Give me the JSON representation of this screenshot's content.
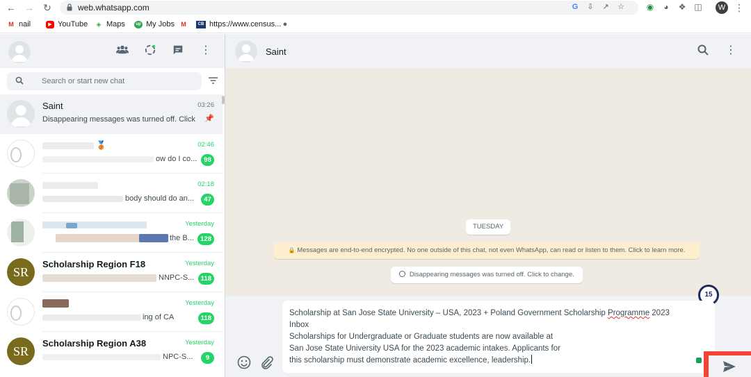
{
  "browser": {
    "url": "web.whatsapp.com",
    "profile_initial": "W",
    "bookmarks": [
      {
        "label": "nail",
        "icon": "gmail-icon"
      },
      {
        "label": "YouTube",
        "icon": "youtube-icon"
      },
      {
        "label": "Maps",
        "icon": "maps-icon"
      },
      {
        "label": "My Jobs",
        "icon": "myjobs-icon"
      },
      {
        "label": "",
        "icon": "gmail-icon"
      },
      {
        "label": "https://www.census...",
        "icon": "census-icon"
      },
      {
        "label": "",
        "icon": "globe-icon"
      }
    ]
  },
  "sidebar": {
    "search_placeholder": "Search or start new chat",
    "chats": [
      {
        "name": "Saint",
        "time": "03:26",
        "preview": "Disappearing messages was turned off. Click ...",
        "badge": "",
        "pinned": true,
        "active": true
      },
      {
        "name": "",
        "time": "02:46",
        "preview": "ow do I co...",
        "badge": "98"
      },
      {
        "name": "",
        "time": "02:18",
        "preview": "body should do an...",
        "badge": "47"
      },
      {
        "name": "",
        "time": "Yesterday",
        "preview": "the B...",
        "badge": "128"
      },
      {
        "name": "Scholarship Region F18",
        "time": "Yesterday",
        "preview": "NNPC-S...",
        "badge": "118",
        "avatar_text": "SR"
      },
      {
        "name": "",
        "time": "Yesterday",
        "preview": "ing of CA",
        "badge": "118"
      },
      {
        "name": "Scholarship Region A38",
        "time": "Yesterday",
        "preview": "NPC-S...",
        "badge": "9",
        "avatar_text": "SR"
      }
    ]
  },
  "conversation": {
    "name": "Saint",
    "date_label": "TUESDAY",
    "encryption_notice": "Messages are end-to-end encrypted. No one outside of this chat, not even WhatsApp, can read or listen to them. Click to learn more.",
    "disappearing_notice": "Disappearing messages was turned off. Click to change.",
    "compose_lines": [
      "Scholarship at San Jose State University – USA, 2023 + Poland Government Scholarship ",
      "Inbox",
      "Scholarships for Undergraduate or Graduate students are now available at",
      "San Jose State University USA for the 2023 academic intakes. Applicants for",
      "this scholarship must demonstrate academic excellence, leadership."
    ],
    "compose_squiggle_word": "Programme",
    "compose_line1_tail": " 2023",
    "counter": "15"
  },
  "colors": {
    "accent": "#25d366",
    "header_bg": "#f0f2f5",
    "chat_bg": "#efeae2",
    "highlight": "#f44336"
  }
}
